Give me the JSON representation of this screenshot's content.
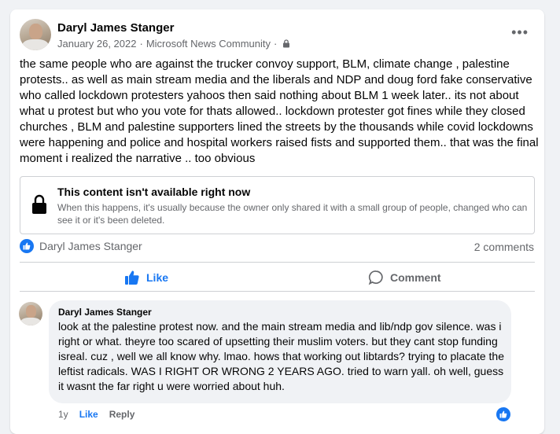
{
  "post": {
    "author": "Daryl James Stanger",
    "date": "January 26, 2022",
    "separator": "·",
    "group": "Microsoft News Community",
    "audience_icon": "lock-icon",
    "more_icon": "more-icon",
    "text": "the same people who are against the trucker convoy support, BLM, climate change , palestine protests.. as well as main stream media and the liberals and NDP and doug ford fake conservative who called lockdown protesters yahoos then said nothing about BLM 1 week later.. its not about what u protest but who you vote for thats allowed.. lockdown protester got fines while they closed churches , BLM and palestine supporters lined the streets by the thousands while covid lockdowns were happening and police and hospital workers raised fists and supported them.. that was the final moment i realized the narrative .. too obvious"
  },
  "unavailable": {
    "title": "This content isn't available right now",
    "description": "When this happens, it's usually because the owner only shared it with a small group of people, changed who can see it or it's been deleted."
  },
  "reactions": {
    "liker": "Daryl James Stanger",
    "comments_count": "2 comments"
  },
  "actions": {
    "like_label": "Like",
    "comment_label": "Comment"
  },
  "comment": {
    "author": "Daryl James Stanger",
    "text": "look at the palestine protest now. and the main stream media and lib/ndp gov silence. was i right or what. theyre too scared of upsetting their muslim voters. but they cant stop funding isreal. cuz , well we all know why. lmao. hows that working out libtards? trying to placate the leftist radicals. WAS I RIGHT OR WRONG 2 YEARS AGO. tried to warn yall. oh well, guess it wasnt the far right u were worried about huh.",
    "time": "1y",
    "like_label": "Like",
    "reply_label": "Reply"
  },
  "colors": {
    "accent": "#1877f2",
    "secondary_text": "#65676b",
    "bubble": "#f0f2f5"
  }
}
